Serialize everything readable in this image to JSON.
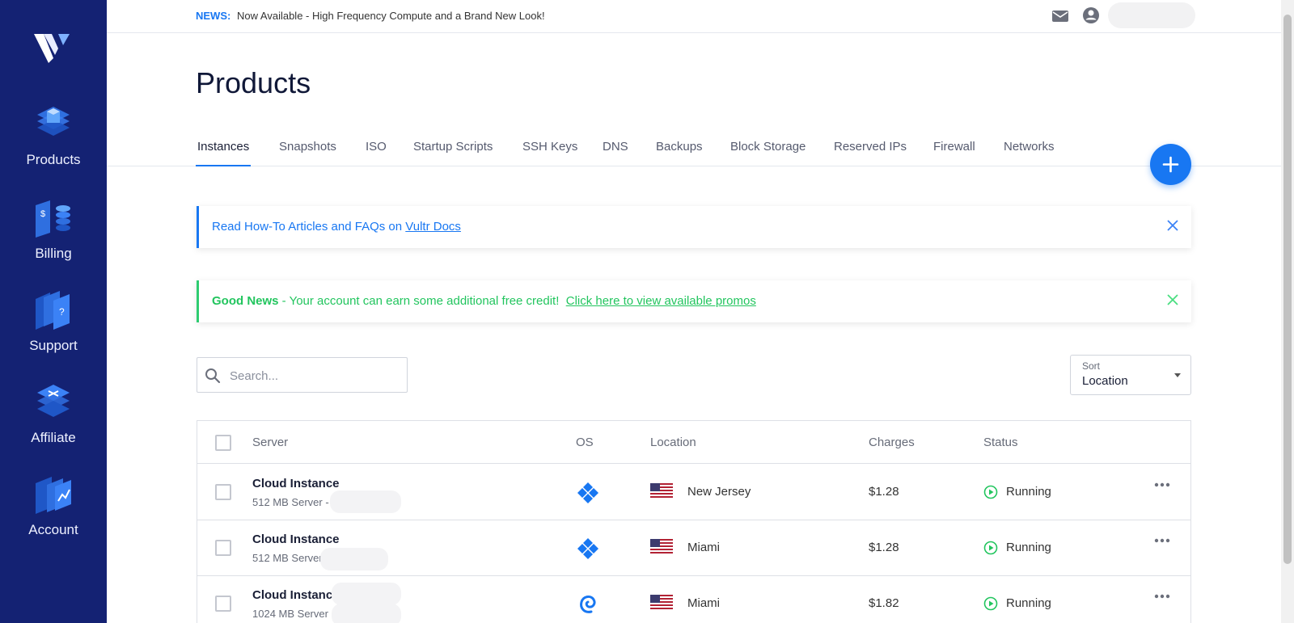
{
  "sidebar": {
    "items": [
      {
        "label": "Products",
        "icon": "products-icon"
      },
      {
        "label": "Billing",
        "icon": "billing-icon"
      },
      {
        "label": "Support",
        "icon": "support-icon"
      },
      {
        "label": "Affiliate",
        "icon": "affiliate-icon"
      },
      {
        "label": "Account",
        "icon": "account-icon"
      }
    ]
  },
  "topbar": {
    "news_label": "NEWS:",
    "news_text": "Now Available - High Frequency Compute and a Brand New Look!"
  },
  "page": {
    "title": "Products"
  },
  "tabs": [
    {
      "label": "Instances",
      "active": true
    },
    {
      "label": "Snapshots"
    },
    {
      "label": "ISO"
    },
    {
      "label": "Startup Scripts"
    },
    {
      "label": "SSH Keys"
    },
    {
      "label": "DNS"
    },
    {
      "label": "Backups"
    },
    {
      "label": "Block Storage"
    },
    {
      "label": "Reserved IPs"
    },
    {
      "label": "Firewall"
    },
    {
      "label": "Networks"
    }
  ],
  "alerts": {
    "info": {
      "text": "Read How-To Articles and FAQs on ",
      "link": "Vultr Docs"
    },
    "promo": {
      "bold": "Good News",
      "text": " - Your account can earn some additional free credit!  ",
      "link": "Click here to view available promos"
    }
  },
  "search": {
    "placeholder": "Search..."
  },
  "sort": {
    "label": "Sort",
    "value": "Location"
  },
  "table": {
    "columns": {
      "server": "Server",
      "os": "OS",
      "location": "Location",
      "charges": "Charges",
      "status": "Status"
    },
    "rows": [
      {
        "name": "Cloud Instance",
        "desc": "512 MB Server -",
        "os": "vultr-os-icon",
        "location": "New Jersey",
        "charges": "$1.28",
        "status": "Running"
      },
      {
        "name": "Cloud Instance",
        "desc": "512 MB Server",
        "os": "vultr-os-icon",
        "location": "Miami",
        "charges": "$1.28",
        "status": "Running"
      },
      {
        "name": "Cloud Instance",
        "desc": "1024 MB Server -",
        "os": "debian-icon",
        "location": "Miami",
        "charges": "$1.82",
        "status": "Running"
      }
    ]
  },
  "colors": {
    "sidebar": "#142273",
    "accent": "#1877f2",
    "success": "#22c55e"
  }
}
